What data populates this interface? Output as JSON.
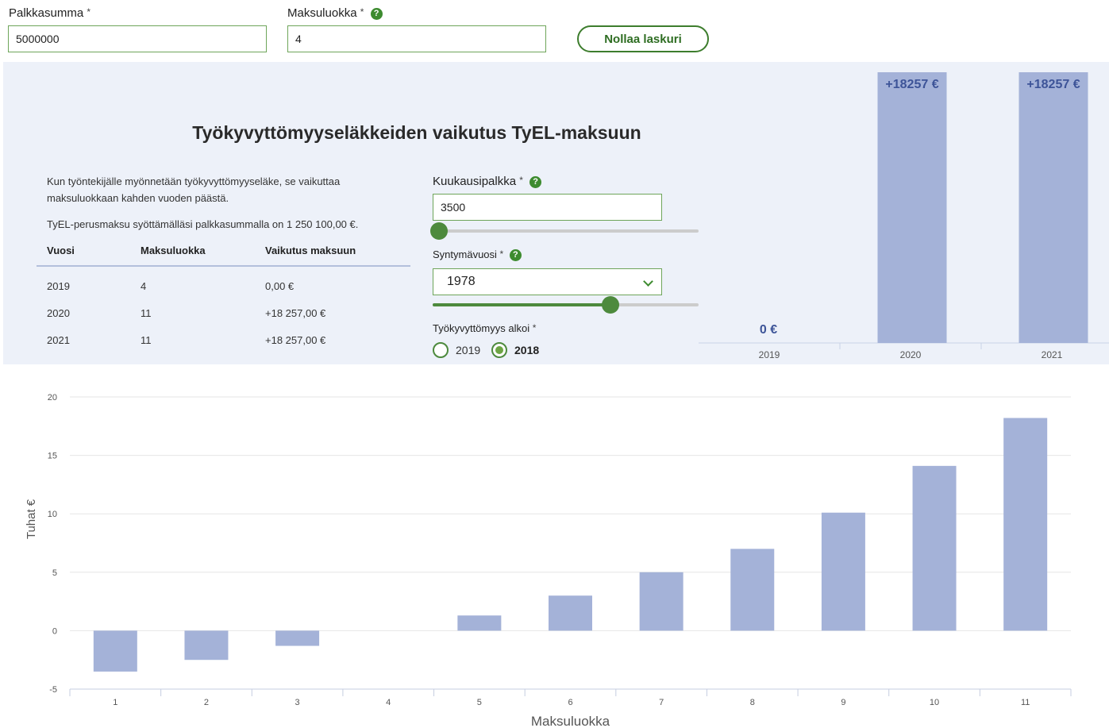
{
  "top_form": {
    "salary_label": "Palkkasumma",
    "salary_value": "5000000",
    "class_label": "Maksuluokka",
    "class_value": "4",
    "required_mark": "*",
    "help_glyph": "?",
    "reset_label": "Nollaa laskuri"
  },
  "panel": {
    "title": "Työkyvyttömyyseläkkeiden vaikutus TyEL-maksuun",
    "desc_1": "Kun työntekijälle myönnetään työkyvyttömyyseläke, se vaikuttaa maksuluokkaan kahden vuoden päästä.",
    "desc_2": "TyEL-perusmaksu syöttämälläsi palkkasummalla on 1 250 100,00 €.",
    "table": {
      "headers": [
        "Vuosi",
        "Maksuluokka",
        "Vaikutus maksuun"
      ],
      "rows": [
        [
          "2019",
          "4",
          "0,00 €"
        ],
        [
          "2020",
          "11",
          "+18 257,00 €"
        ],
        [
          "2021",
          "11",
          "+18 257,00 €"
        ]
      ]
    },
    "monthly_salary_label": "Kuukausipalkka",
    "monthly_salary_value": "3500",
    "monthly_salary_slider": 0.0,
    "birth_year_label": "Syntymävuosi",
    "birth_year_value": "1978",
    "birth_year_slider": 0.68,
    "disability_start_label": "Työkyvyttömyys alkoi",
    "disability_options": [
      {
        "label": "2019",
        "checked": false
      },
      {
        "label": "2018",
        "checked": true
      }
    ]
  },
  "colors": {
    "bar": "#a4b2d8",
    "bar_label": "#3d5498",
    "green": "#4d8a3d",
    "panel_bg": "#edf1f9"
  },
  "chart_data": [
    {
      "type": "bar",
      "categories": [
        "2019",
        "2020",
        "2021"
      ],
      "values": [
        0,
        18257,
        18257
      ],
      "data_labels": [
        "0 €",
        "+18257 €",
        "+18257 €"
      ],
      "ylim": [
        0,
        18257
      ]
    },
    {
      "type": "bar",
      "categories": [
        "1",
        "2",
        "3",
        "4",
        "5",
        "6",
        "7",
        "8",
        "9",
        "10",
        "11"
      ],
      "values": [
        -3.5,
        -2.5,
        -1.3,
        0,
        1.3,
        3.0,
        5.0,
        7.0,
        10.1,
        14.1,
        18.2
      ],
      "xlabel": "Maksuluokka",
      "ylabel": "Tuhat €",
      "yticks": [
        "20",
        "15",
        "10",
        "5",
        "0",
        "-5"
      ],
      "ylim": [
        -5,
        20
      ],
      "grid": true
    }
  ]
}
